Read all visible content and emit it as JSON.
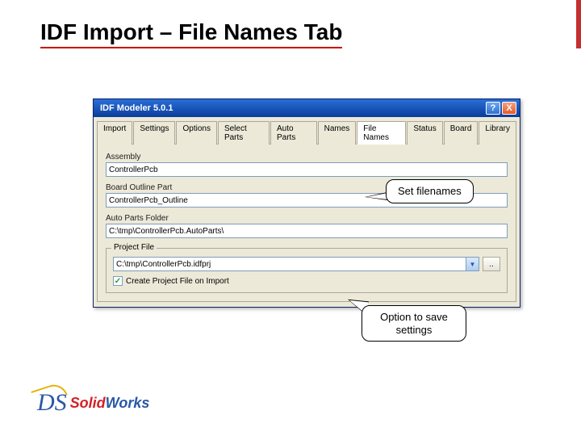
{
  "slide": {
    "title": "IDF Import – File Names Tab"
  },
  "dialog": {
    "title": "IDF Modeler 5.0.1",
    "help_symbol": "?",
    "close_symbol": "X"
  },
  "tabs": [
    "Import",
    "Settings",
    "Options",
    "Select Parts",
    "Auto Parts",
    "Names",
    "File Names",
    "Status",
    "Board",
    "Library"
  ],
  "active_tab": 6,
  "fields": {
    "assembly_label": "Assembly",
    "assembly_value": "ControllerPcb",
    "board_label": "Board Outline Part",
    "board_value": "ControllerPcb_Outline",
    "autoparts_label": "Auto Parts Folder",
    "autoparts_value": "C:\\tmp\\ControllerPcb.AutoParts\\"
  },
  "project": {
    "legend": "Project File",
    "value": "C:\\tmp\\ControllerPcb.idfprj",
    "browse": "..",
    "checkbox_label": "Create Project File on Import",
    "checked": true
  },
  "callouts": {
    "c1": "Set filenames",
    "c2": "Option to save settings"
  },
  "logo": {
    "ds": "DS",
    "solid": "Solid",
    "works": "Works"
  }
}
